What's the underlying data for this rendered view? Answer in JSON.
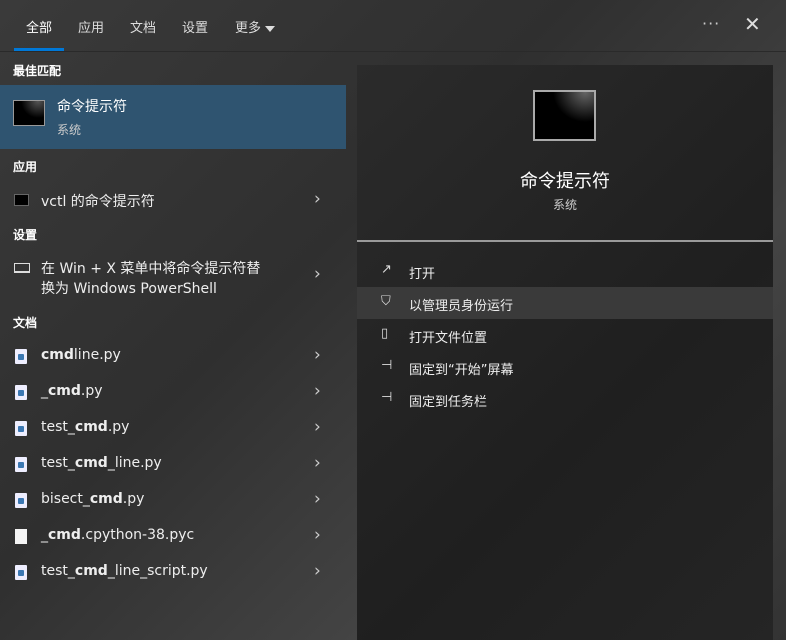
{
  "tabs": [
    "全部",
    "应用",
    "文档",
    "设置",
    "更多"
  ],
  "sections": {
    "best": "最佳匹配",
    "apps": "应用",
    "settings": "设置",
    "docs": "文档"
  },
  "best_match": {
    "title": "命令提示符",
    "subtitle": "系统"
  },
  "apps": [
    {
      "label": "vctl 的命令提示符"
    }
  ],
  "settings": [
    {
      "line1": "在 Win + X 菜单中将命令提示符替",
      "line2": "换为 Windows PowerShell"
    }
  ],
  "docs": [
    {
      "pre": "",
      "bold": "cmd",
      "post": "line.py",
      "icon": "python-file"
    },
    {
      "pre": "_",
      "bold": "cmd",
      "post": ".py",
      "icon": "python-file"
    },
    {
      "pre": "test_",
      "bold": "cmd",
      "post": ".py",
      "icon": "python-file"
    },
    {
      "pre": "test_",
      "bold": "cmd",
      "post": "_line.py",
      "icon": "python-file"
    },
    {
      "pre": "bisect_",
      "bold": "cmd",
      "post": ".py",
      "icon": "python-file"
    },
    {
      "pre": "_",
      "bold": "cmd",
      "post": ".cpython-38.pyc",
      "icon": "file"
    },
    {
      "pre": "test_",
      "bold": "cmd",
      "post": "_line_script.py",
      "icon": "python-file"
    }
  ],
  "preview": {
    "title": "命令提示符",
    "subtitle": "系统"
  },
  "actions": [
    {
      "label": "打开",
      "icon": "open-icon"
    },
    {
      "label": "以管理员身份运行",
      "icon": "shield-icon"
    },
    {
      "label": "打开文件位置",
      "icon": "folder-icon"
    },
    {
      "label": "固定到“开始”屏幕",
      "icon": "pin-icon"
    },
    {
      "label": "固定到任务栏",
      "icon": "pin-icon"
    }
  ],
  "colors": {
    "accent": "#0078d7",
    "selected": "#2f5470"
  }
}
